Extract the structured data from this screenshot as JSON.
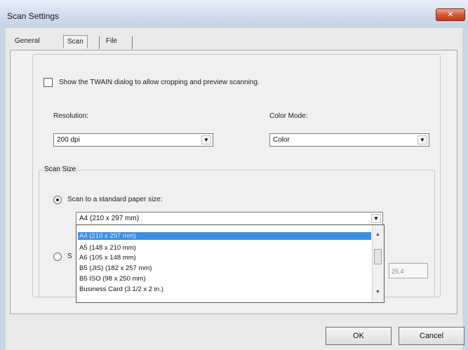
{
  "window": {
    "title": "Scan Settings",
    "close_label": "✕"
  },
  "tabs": [
    {
      "label": "General"
    },
    {
      "label": "Scan"
    },
    {
      "label": "File"
    }
  ],
  "scan": {
    "twain_checkbox_label": "Show the TWAIN dialog to allow cropping and preview scanning.",
    "twain_checked": false,
    "resolution_label": "Resolution:",
    "resolution_value": "200 dpi",
    "color_mode_label": "Color Mode:",
    "color_mode_value": "Color"
  },
  "scan_size": {
    "group_label": "Scan Size",
    "standard_radio_label": "Scan to a standard paper size:",
    "standard_selected": true,
    "custom_radio_label": "S",
    "paper_selected": "A4 (210 x 297 mm)",
    "paper_options": [
      "A4 (210 x 297 mm)",
      "A5 (148 x 210 mm)",
      "A6 (105 x 148 mm)",
      "B5 (JIS) (182 x 257 mm)",
      "B5 ISO (98 x 250 mm)",
      "Business Card (3 1/2 x 2 in.)"
    ],
    "custom_value": "25.4"
  },
  "buttons": {
    "ok": "OK",
    "cancel": "Cancel"
  }
}
